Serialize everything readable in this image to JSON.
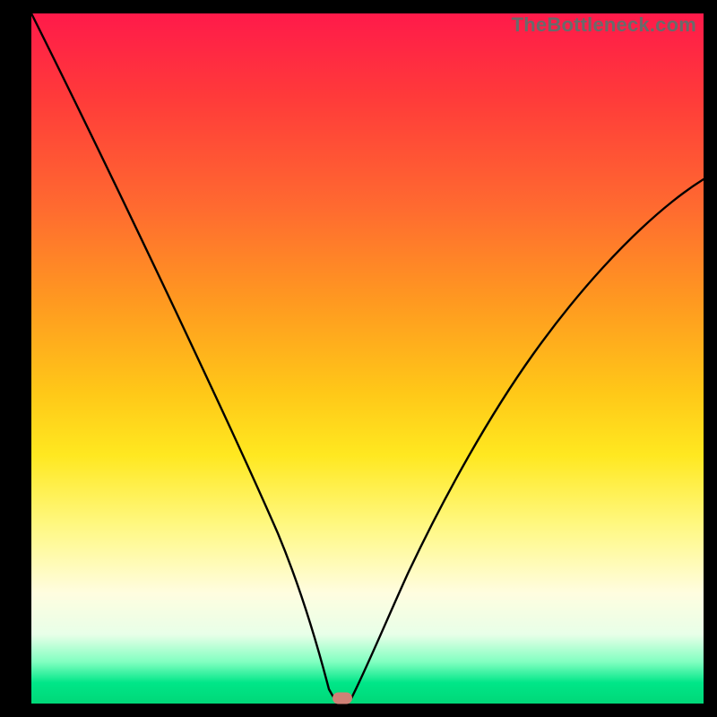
{
  "watermark": "TheBottleneck.com",
  "chart_data": {
    "type": "line",
    "title": "",
    "xlabel": "",
    "ylabel": "",
    "x": [
      0.0,
      0.05,
      0.1,
      0.15,
      0.2,
      0.25,
      0.3,
      0.35,
      0.4,
      0.43,
      0.45,
      0.46,
      0.5,
      0.55,
      0.6,
      0.65,
      0.7,
      0.75,
      0.8,
      0.85,
      0.9,
      0.95,
      1.0
    ],
    "values": [
      1.0,
      0.87,
      0.74,
      0.62,
      0.5,
      0.38,
      0.27,
      0.17,
      0.08,
      0.02,
      0.0,
      0.0,
      0.06,
      0.14,
      0.22,
      0.3,
      0.38,
      0.45,
      0.52,
      0.59,
      0.65,
      0.7,
      0.75
    ],
    "xlim": [
      0,
      1
    ],
    "ylim": [
      0,
      1
    ],
    "marker": {
      "x": 0.455,
      "y": 0.0
    },
    "background_gradient": [
      "#ff1a4a",
      "#ffe820",
      "#00d878"
    ],
    "annotations": []
  }
}
